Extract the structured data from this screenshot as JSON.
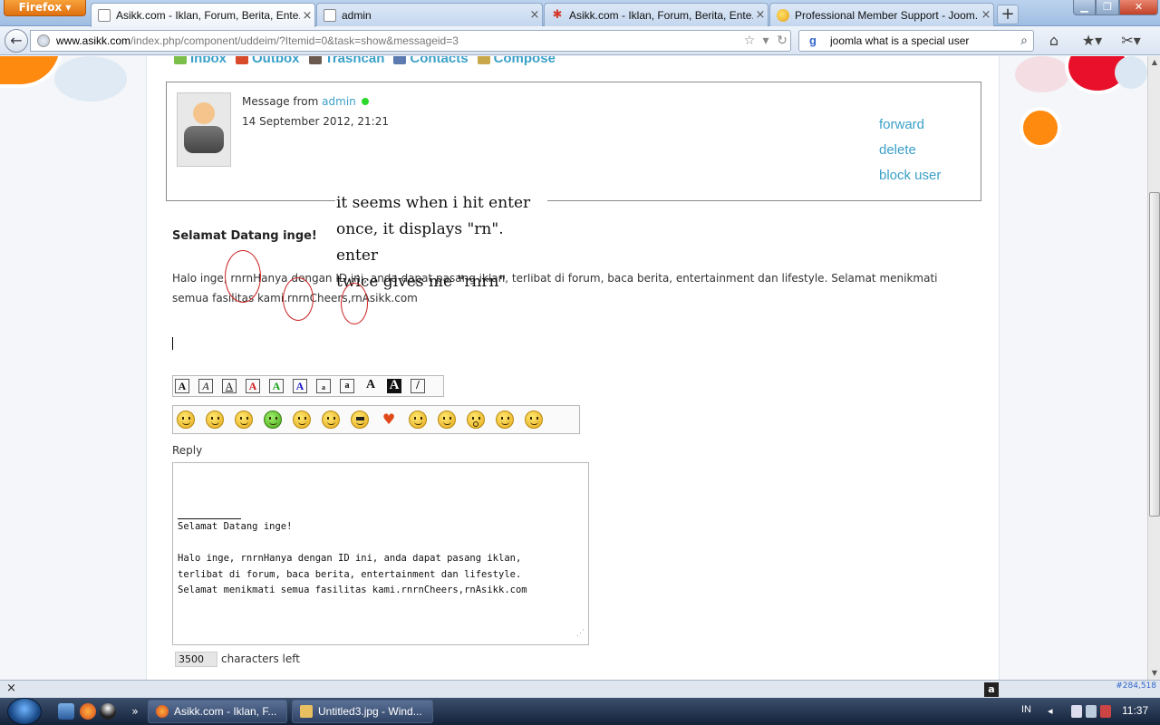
{
  "browser": {
    "app_button": "Firefox",
    "tabs": [
      {
        "label": "Asikk.com - Iklan, Forum, Berita, Ente...",
        "active": true
      },
      {
        "label": "admin",
        "active": false
      },
      {
        "label": "Asikk.com - Iklan, Forum, Berita, Ente...",
        "active": false
      },
      {
        "label": "Professional Member Support - Joom...",
        "active": false
      }
    ],
    "new_tab": "+",
    "url_host": "www.asikk.com",
    "url_path": "/index.php/component/uddeim/?Itemid=0&task=show&messageid=3",
    "search_engine": "g",
    "search_query": "joomla what is a special user"
  },
  "pm_nav": {
    "inbox": "Inbox",
    "outbox": "Outbox",
    "trashcan": "Trashcan",
    "contacts": "Contacts",
    "compose": "Compose"
  },
  "message": {
    "from_prefix": "Message from",
    "from_user": "admin",
    "date": "14 September 2012, 21:21",
    "actions": {
      "forward": "forward",
      "delete": "delete",
      "block": "block user"
    },
    "heading": "Selamat Datang inge!",
    "body": "Halo inge, rnrnHanya dengan ID ini, anda dapat pasang iklan, terlibat di forum, baca berita, entertainment dan lifestyle. Selamat menikmati semua fasilitas kami.rnrnCheers,rnAsikk.com"
  },
  "annotation": {
    "lines": [
      "it seems when i hit enter",
      "once, it displays \"rn\". enter",
      "twice gives me \"rnrn\""
    ]
  },
  "format_buttons": [
    "A",
    "A",
    "A",
    "A",
    "A",
    "A",
    "a",
    "a",
    "A",
    "A",
    "/"
  ],
  "reply": {
    "label": "Reply",
    "quoted_heading": "Selamat Datang inge!",
    "quoted_lines": [
      "Halo inge, rnrnHanya dengan ID ini, anda dapat pasang iklan,",
      "terlibat di forum, baca berita, entertainment dan lifestyle.",
      "Selamat menikmati semua fasilitas kami.rnrnCheers,rnAsikk.com"
    ],
    "chars_left_value": "3500",
    "chars_left_label": "characters left"
  },
  "status_bar": {
    "close": "×",
    "counter": "#284,518"
  },
  "taskbar": {
    "tasks": [
      {
        "label": "Asikk.com - Iklan, F..."
      },
      {
        "label": "Untitled3.jpg - Wind..."
      }
    ],
    "language": "IN",
    "clock": "11:37"
  },
  "colors": {
    "link": "#3aa0c8",
    "annotation_circle": "#cc2020",
    "online": "#2bd82b"
  }
}
